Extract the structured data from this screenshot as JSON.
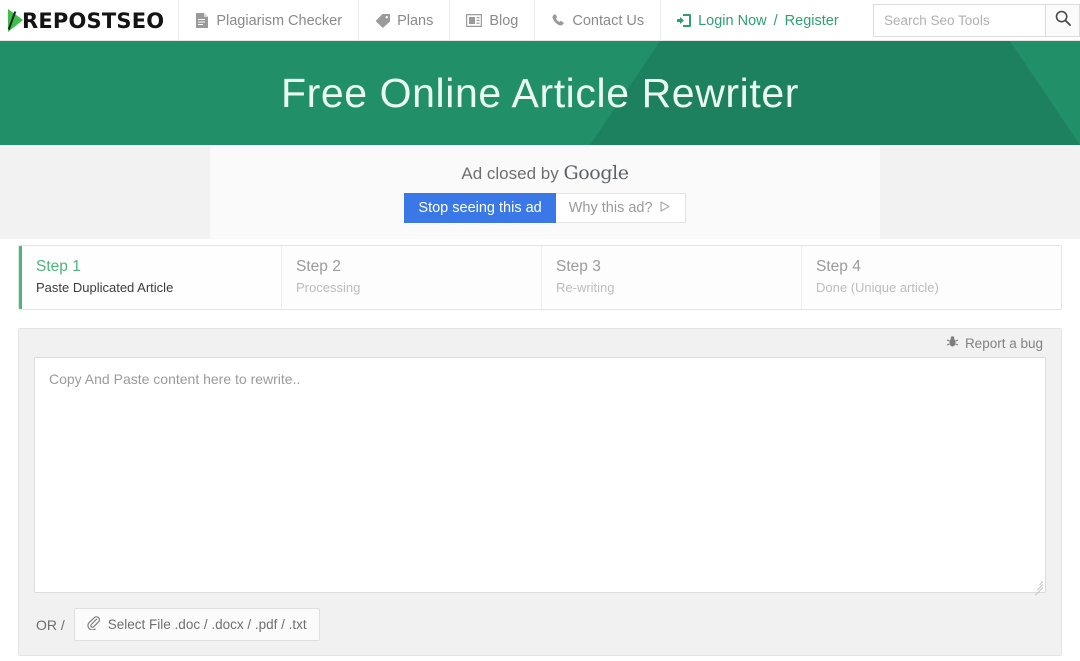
{
  "brand": {
    "logo_text": "REPOSTSEO",
    "logo_icon": "play-triangle-logo-icon",
    "accent_green": "#3cc04a"
  },
  "nav": {
    "items": [
      {
        "label": "Plagiarism Checker",
        "icon": "document-icon"
      },
      {
        "label": "Plans",
        "icon": "tag-icon"
      },
      {
        "label": "Blog",
        "icon": "newspaper-icon"
      },
      {
        "label": "Contact Us",
        "icon": "phone-icon"
      }
    ],
    "login": {
      "icon": "sign-in-icon",
      "label": "Login Now",
      "separator": "/",
      "register_label": "Register",
      "color": "#2f9e72"
    }
  },
  "search": {
    "placeholder": "Search Seo Tools",
    "value": "",
    "icon": "search-icon"
  },
  "hero": {
    "title": "Free Online Article Rewriter",
    "background": "#219069",
    "shade": "#1d8160"
  },
  "ad": {
    "closed_text": "Ad closed by",
    "brand": "Google",
    "stop_button": "Stop seeing this ad",
    "why_button": "Why this ad?",
    "why_icon": "adchoices-triangle-icon",
    "primary_color": "#3b78e7"
  },
  "steps": [
    {
      "title": "Step 1",
      "sub": "Paste Duplicated Article",
      "active": true
    },
    {
      "title": "Step 2",
      "sub": "Processing",
      "active": false
    },
    {
      "title": "Step 3",
      "sub": "Re-writing",
      "active": false
    },
    {
      "title": "Step 4",
      "sub": "Done (Unique article)",
      "active": false
    }
  ],
  "editor": {
    "report_bug_label": "Report a bug",
    "report_bug_icon": "bug-icon",
    "placeholder": "Copy And Paste content here to rewrite..",
    "value": "",
    "or_label": "OR /",
    "file_button_label": "Select File .doc / .docx / .pdf / .txt",
    "file_button_icon": "paperclip-icon"
  }
}
